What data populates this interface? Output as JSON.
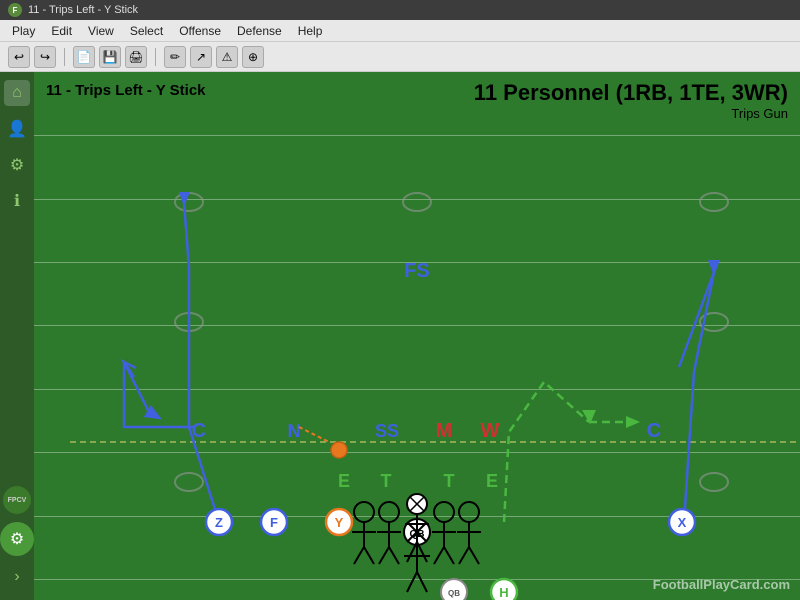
{
  "titlebar": {
    "title": "11 - Trips Left - Y Stick",
    "app_name": "FPCV"
  },
  "menubar": {
    "items": [
      "Play",
      "Edit",
      "View",
      "Select",
      "Offense",
      "Defense",
      "Help"
    ]
  },
  "toolbar": {
    "buttons": [
      "↩",
      "↪",
      "📄",
      "💾",
      "🔲",
      "✏️",
      "⚠",
      "⊕"
    ]
  },
  "sidebar": {
    "icons": [
      "🏠",
      "👤",
      "⚙",
      "ℹ"
    ]
  },
  "play": {
    "name": "11 - Trips Left - Y Stick",
    "formation": "11 Personnel (1RB, 1TE, 3WR)",
    "sub_formation": "Trips Gun"
  },
  "players": {
    "offense": [
      {
        "id": "QB",
        "label": "QB",
        "type": "circle_x",
        "color": "#000"
      },
      {
        "id": "H",
        "label": "H",
        "color": "#4ab840"
      },
      {
        "id": "Y",
        "label": "Y",
        "color": "#e87820"
      },
      {
        "id": "Z",
        "label": "Z",
        "color": "#4060e0"
      },
      {
        "id": "F",
        "label": "F",
        "color": "#4060e0"
      },
      {
        "id": "X",
        "label": "X",
        "color": "#4060e0"
      }
    ],
    "defense": [
      {
        "id": "FS",
        "label": "FS",
        "color": "#4060e0"
      },
      {
        "id": "SS",
        "label": "SS",
        "color": "#4060e0"
      },
      {
        "id": "M",
        "label": "M",
        "color": "#d03030"
      },
      {
        "id": "W",
        "label": "W",
        "color": "#d03030"
      },
      {
        "id": "C_left",
        "label": "C",
        "color": "#4060e0"
      },
      {
        "id": "C_right",
        "label": "C",
        "color": "#4060e0"
      },
      {
        "id": "N",
        "label": "N",
        "color": "#4060e0"
      },
      {
        "id": "E_left",
        "label": "E",
        "color": "#4ab840"
      },
      {
        "id": "T_left",
        "label": "T",
        "color": "#4ab840"
      },
      {
        "id": "T_right",
        "label": "T",
        "color": "#4ab840"
      },
      {
        "id": "E_right",
        "label": "E",
        "color": "#4ab840"
      }
    ]
  },
  "watermark": "FootballPlayCard.com",
  "colors": {
    "field": "#2d7a2d",
    "sidebar": "#2d5a27",
    "route_blue": "#4060e0",
    "route_green": "#4ab840",
    "player_orange": "#e87820"
  }
}
